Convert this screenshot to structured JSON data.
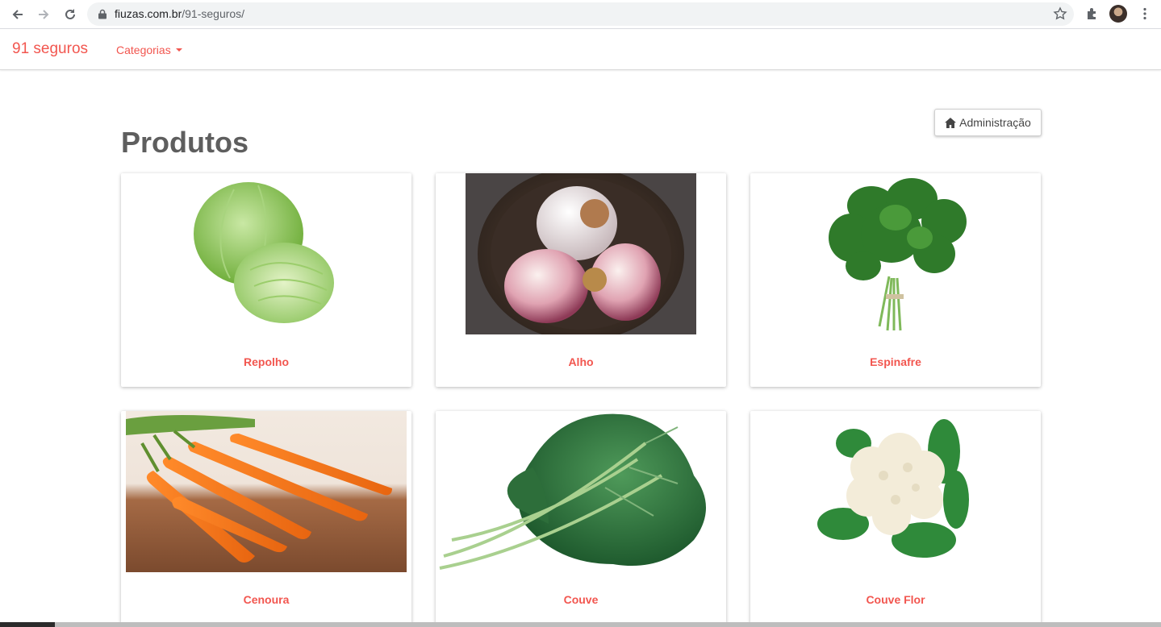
{
  "browser": {
    "url_domain": "fiuzas.com.br",
    "url_path": "/91-seguros/"
  },
  "navbar": {
    "brand": "91 seguros",
    "categories_label": "Categorias"
  },
  "main": {
    "title": "Produtos",
    "admin_button": "Administração"
  },
  "products": [
    {
      "name": "Repolho"
    },
    {
      "name": "Alho"
    },
    {
      "name": "Espinafre"
    },
    {
      "name": "Cenoura"
    },
    {
      "name": "Couve"
    },
    {
      "name": "Couve Flor"
    }
  ],
  "colors": {
    "accent": "#f2564f",
    "title": "#5e5e5e"
  },
  "icons": [
    "back-arrow-icon",
    "forward-arrow-icon",
    "reload-icon",
    "lock-icon",
    "star-icon",
    "puzzle-icon",
    "menu-dots-icon",
    "home-icon"
  ]
}
